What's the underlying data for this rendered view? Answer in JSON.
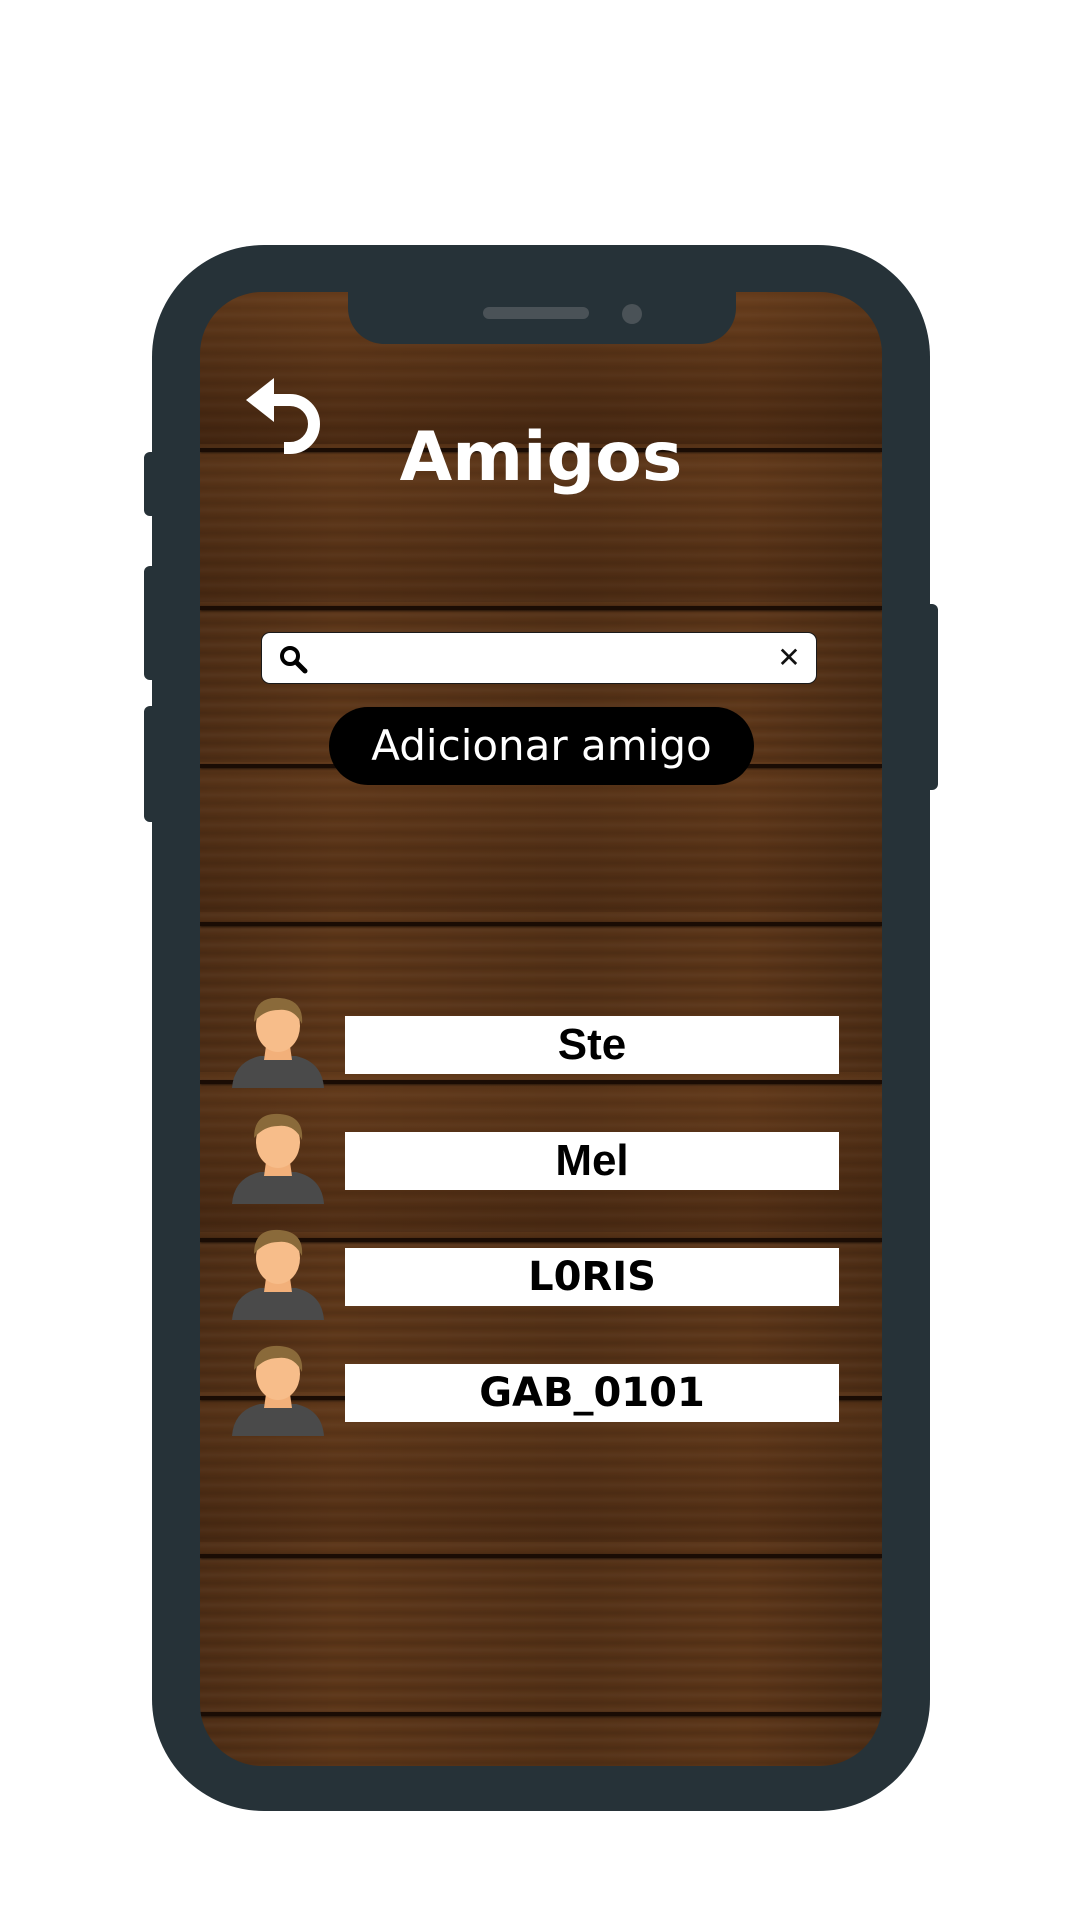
{
  "header": {
    "title": "Amigos"
  },
  "search": {
    "placeholder": "",
    "value": "",
    "clear_symbol": "✕"
  },
  "add_friend": {
    "label": "Adicionar amigo"
  },
  "friends": [
    {
      "name": "Ste"
    },
    {
      "name": "Mel"
    },
    {
      "name": "L0RIS"
    },
    {
      "name": "GAB_0101"
    }
  ],
  "colors": {
    "frame": "#263238",
    "wood": "#5b3518",
    "button": "#000000",
    "text_light": "#ffffff"
  },
  "icons": [
    "back-arrow-icon",
    "search-icon",
    "clear-icon",
    "user-avatar-icon"
  ]
}
